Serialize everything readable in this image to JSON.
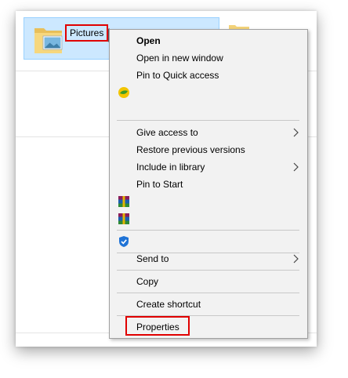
{
  "explorer": {
    "selected_folder": {
      "label": "Pictures",
      "icon": "pictures-folder-icon"
    },
    "partial_folder_icon": "folder-icon"
  },
  "context_menu": {
    "open": "Open",
    "open_new_window": "Open in new window",
    "pin_quick_access": "Pin to Quick access",
    "give_access_to": "Give access to",
    "restore_previous_versions": "Restore previous versions",
    "include_in_library": "Include in library",
    "pin_to_start": "Pin to Start",
    "send_to": "Send to",
    "copy": "Copy",
    "create_shortcut": "Create shortcut",
    "properties": "Properties",
    "icons": {
      "app_icon_1": "green-yellow-circle-icon",
      "archive_icon_1": "winrar-icon",
      "archive_icon_2": "winrar-icon",
      "defender_icon": "windows-defender-shield-icon",
      "submenu": "chevron-right-icon"
    }
  },
  "colors": {
    "selection_bg": "#cce8ff",
    "selection_border": "#99d1ff",
    "menu_bg": "#f2f2f2",
    "highlight_red": "#e00000"
  }
}
